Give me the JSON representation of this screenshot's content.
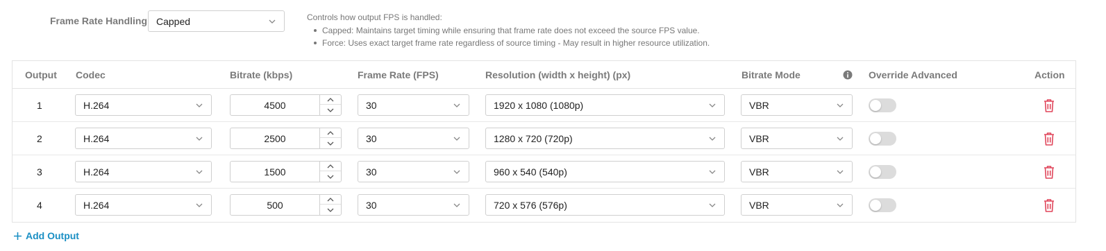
{
  "frame_rate_handling": {
    "label": "Frame Rate Handling",
    "selected": "Capped",
    "help_title": "Controls how output FPS is handled:",
    "help_items": [
      "Capped: Maintains target timing while ensuring that frame rate does not exceed the source FPS value.",
      "Force: Uses exact target frame rate regardless of source timing - May result in higher resource utilization."
    ]
  },
  "table": {
    "headers": {
      "output": "Output",
      "codec": "Codec",
      "bitrate": "Bitrate (kbps)",
      "frame_rate": "Frame Rate (FPS)",
      "resolution": "Resolution (width x height) (px)",
      "bitrate_mode": "Bitrate Mode",
      "override_advanced": "Override Advanced",
      "action": "Action"
    },
    "rows": [
      {
        "output": "1",
        "codec": "H.264",
        "bitrate": "4500",
        "frame_rate": "30",
        "resolution": "1920 x 1080 (1080p)",
        "bitrate_mode": "VBR",
        "override": false
      },
      {
        "output": "2",
        "codec": "H.264",
        "bitrate": "2500",
        "frame_rate": "30",
        "resolution": "1280 x 720 (720p)",
        "bitrate_mode": "VBR",
        "override": false
      },
      {
        "output": "3",
        "codec": "H.264",
        "bitrate": "1500",
        "frame_rate": "30",
        "resolution": "960 x 540 (540p)",
        "bitrate_mode": "VBR",
        "override": false
      },
      {
        "output": "4",
        "codec": "H.264",
        "bitrate": "500",
        "frame_rate": "30",
        "resolution": "720 x 576 (576p)",
        "bitrate_mode": "VBR",
        "override": false
      }
    ]
  },
  "add_output_label": "Add Output",
  "icons": {
    "chevron": "chevron-down-icon",
    "info": "info-icon",
    "trash": "trash-icon",
    "plus": "plus-icon",
    "stepper_up": "caret-up-icon",
    "stepper_down": "caret-down-icon"
  },
  "colors": {
    "accent": "#1a8fc4",
    "delete": "#e0455a",
    "toggle_off": "#dcdcdc"
  }
}
